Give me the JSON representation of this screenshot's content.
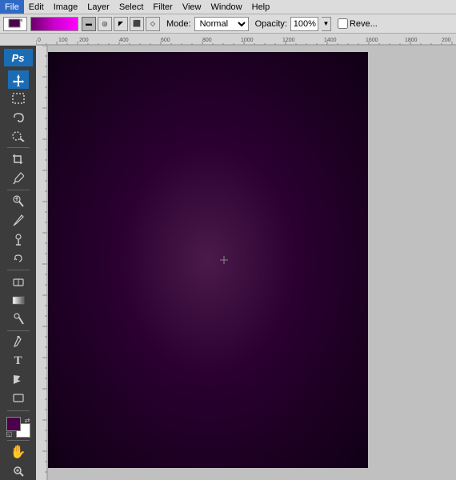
{
  "menubar": {
    "items": [
      {
        "label": "File",
        "name": "file-menu"
      },
      {
        "label": "Edit",
        "name": "edit-menu"
      },
      {
        "label": "Image",
        "name": "image-menu"
      },
      {
        "label": "Layer",
        "name": "layer-menu"
      },
      {
        "label": "Select",
        "name": "select-menu"
      },
      {
        "label": "Filter",
        "name": "filter-menu"
      },
      {
        "label": "View",
        "name": "view-menu"
      },
      {
        "label": "Window",
        "name": "window-menu"
      },
      {
        "label": "Help",
        "name": "help-menu"
      }
    ]
  },
  "optionsbar": {
    "mode_label": "Mode:",
    "mode_value": "Normal",
    "opacity_label": "Opacity:",
    "opacity_value": "100%",
    "reverse_label": "Reve..."
  },
  "toolbox": {
    "ps_label": "Ps",
    "tools": [
      {
        "name": "move-tool",
        "icon": "✛",
        "label": "Move Tool"
      },
      {
        "name": "rectangular-marquee-tool",
        "icon": "⬚",
        "label": "Rectangular Marquee"
      },
      {
        "name": "lasso-tool",
        "icon": "⌇",
        "label": "Lasso Tool"
      },
      {
        "name": "quick-selection-tool",
        "icon": "⊕",
        "label": "Quick Selection"
      },
      {
        "name": "crop-tool",
        "icon": "⧠",
        "label": "Crop Tool"
      },
      {
        "name": "eyedropper-tool",
        "icon": "✒",
        "label": "Eyedropper"
      },
      {
        "name": "spot-healing-tool",
        "icon": "⚕",
        "label": "Spot Healing"
      },
      {
        "name": "brush-tool",
        "icon": "✏",
        "label": "Brush Tool"
      },
      {
        "name": "clone-stamp-tool",
        "icon": "✲",
        "label": "Clone Stamp"
      },
      {
        "name": "history-brush-tool",
        "icon": "↺",
        "label": "History Brush"
      },
      {
        "name": "eraser-tool",
        "icon": "◻",
        "label": "Eraser"
      },
      {
        "name": "gradient-tool",
        "icon": "▦",
        "label": "Gradient Tool"
      },
      {
        "name": "dodge-tool",
        "icon": "◯",
        "label": "Dodge Tool"
      },
      {
        "name": "pen-tool",
        "icon": "✒",
        "label": "Pen Tool"
      },
      {
        "name": "type-tool",
        "icon": "T",
        "label": "Type Tool"
      },
      {
        "name": "path-selection-tool",
        "icon": "↖",
        "label": "Path Selection"
      },
      {
        "name": "shape-tool",
        "icon": "▭",
        "label": "Shape Tool"
      },
      {
        "name": "hand-tool",
        "icon": "✋",
        "label": "Hand Tool"
      },
      {
        "name": "zoom-tool",
        "icon": "🔍",
        "label": "Zoom Tool"
      }
    ],
    "fg_color": "#4a004a",
    "bg_color": "#ffffff"
  },
  "ruler": {
    "marks_h": [
      "0",
      "100",
      "200",
      "400",
      "600",
      "800",
      "1000",
      "1200",
      "1400",
      "1600",
      "1800",
      "200"
    ],
    "marks_v": [
      "0",
      "50",
      "100",
      "150",
      "200",
      "250",
      "300",
      "350"
    ]
  },
  "canvas": {
    "background": "radial-gradient dark purple"
  }
}
